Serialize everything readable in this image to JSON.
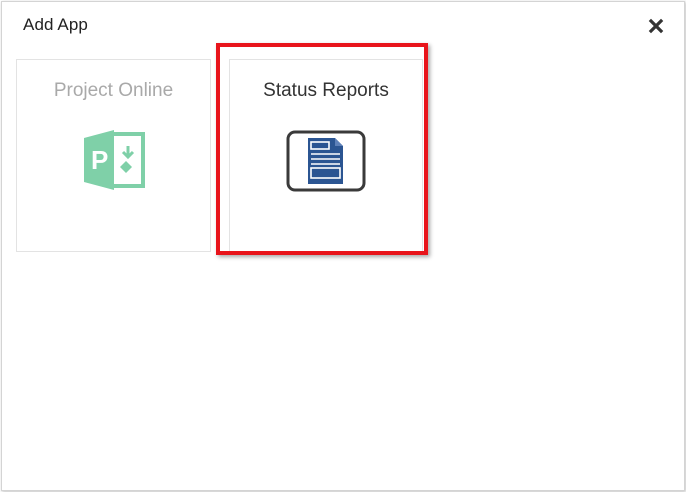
{
  "dialog": {
    "title": "Add App",
    "close_icon": "close-x-icon"
  },
  "apps": [
    {
      "label": "Project Online",
      "icon": "project-online-icon",
      "state": "disabled"
    },
    {
      "label": "Status Reports",
      "icon": "status-report-document-icon",
      "state": "highlighted"
    }
  ],
  "colors": {
    "highlight": "#e8141b",
    "project_icon": "#7fd0a8",
    "status_icon": "#2b5592"
  }
}
